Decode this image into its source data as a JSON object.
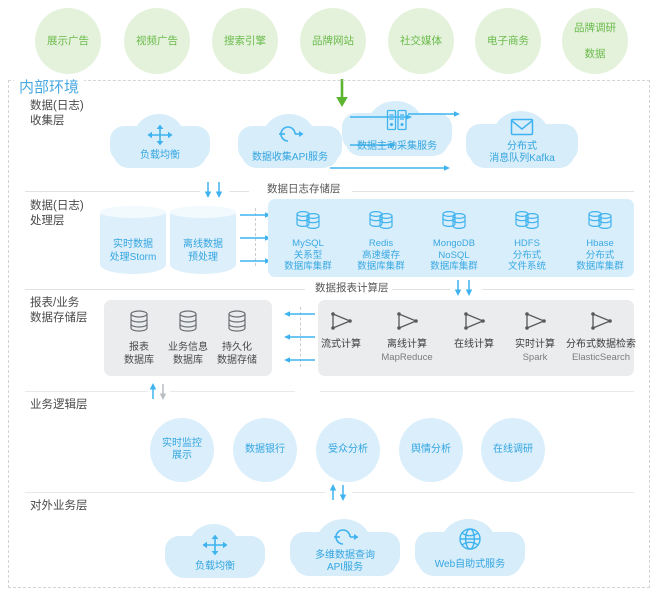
{
  "diagram": {
    "title_internal": "内部环境",
    "external_sources": [
      {
        "label": "展示广告"
      },
      {
        "label": "视频广告"
      },
      {
        "label": "搜索引擎"
      },
      {
        "label": "品牌网站"
      },
      {
        "label": "社交媒体"
      },
      {
        "label": "电子商务"
      },
      {
        "label": "品牌调研\n数据",
        "line1": "品牌调研",
        "line2": "数据"
      }
    ],
    "layers": [
      {
        "id": "collect",
        "label_line1": "数据(日志)",
        "label_line2": "收集层"
      },
      {
        "id": "process",
        "label_line1": "数据(日志)",
        "label_line2": "处理层"
      },
      {
        "id": "report_store",
        "label_line1": "报表/业务",
        "label_line2": "数据存储层"
      },
      {
        "id": "business_logic",
        "label_line1": "业务逻辑层",
        "label_line2": ""
      },
      {
        "id": "external_business",
        "label_line1": "对外业务层",
        "label_line2": ""
      }
    ],
    "sub_layer_titles": {
      "log_storage": "数据日志存储层",
      "report_calc": "数据报表计算层"
    },
    "collect_layer": {
      "clouds": [
        {
          "icon": "load-balancer-icon",
          "line1": "负载均衡",
          "line2": ""
        },
        {
          "icon": "api-refresh-icon",
          "line1": "数据收集API服务",
          "line2": ""
        },
        {
          "icon": "server-rack-icon",
          "line1": "数据主动采集服务",
          "line2": ""
        },
        {
          "icon": "envelope-icon",
          "line1": "分布式",
          "line2": "消息队列Kafka"
        }
      ]
    },
    "process_layer": {
      "cylinders": [
        {
          "line1": "实时数据",
          "line2": "处理Storm"
        },
        {
          "line1": "离线数据",
          "line2": "预处理"
        }
      ],
      "databases": [
        {
          "name": "MySQL",
          "line2": "关系型",
          "line3": "数据库集群"
        },
        {
          "name": "Redis",
          "line2": "高速缓存",
          "line3": "数据库集群"
        },
        {
          "name": "MongoDB",
          "line2": "NoSQL",
          "line3": "数据库集群"
        },
        {
          "name": "HDFS",
          "line2": "分布式",
          "line3": "文件系统"
        },
        {
          "name": "Hbase",
          "line2": "分布式",
          "line3": "数据库集群"
        }
      ]
    },
    "report_store_layer": {
      "databases": [
        {
          "line1": "报表",
          "line2": "数据库"
        },
        {
          "line1": "业务信息",
          "line2": "数据库"
        },
        {
          "line1": "持久化",
          "line2": "数据存储"
        }
      ],
      "compute": [
        {
          "line1": "流式计算",
          "line2": ""
        },
        {
          "line1": "离线计算",
          "line2": "MapReduce"
        },
        {
          "line1": "在线计算",
          "line2": ""
        },
        {
          "line1": "实时计算",
          "line2": "Spark"
        },
        {
          "line1": "分布式数据检索",
          "line2": "ElasticSearch"
        }
      ]
    },
    "business_logic_layer": {
      "items": [
        {
          "line1": "实时监控",
          "line2": "展示"
        },
        {
          "line1": "数据银行",
          "line2": ""
        },
        {
          "line1": "受众分析",
          "line2": ""
        },
        {
          "line1": "舆情分析",
          "line2": ""
        },
        {
          "line1": "在线调研",
          "line2": ""
        }
      ]
    },
    "external_business_layer": {
      "clouds": [
        {
          "icon": "load-balancer-icon",
          "line1": "负载均衡",
          "line2": ""
        },
        {
          "icon": "api-refresh-icon",
          "line1": "多维数据查询",
          "line2": "API服务"
        },
        {
          "icon": "globe-icon",
          "line1": "Web自助式服务",
          "line2": ""
        }
      ]
    },
    "colors": {
      "source_green_fill": "#e4f2dc",
      "source_green_text": "#6aba4a",
      "cloud_blue": "#d7edfa",
      "accent_blue": "#34a5e0",
      "panel_blue": "#d9eefb",
      "panel_gray": "#ebecee",
      "arrow_blue": "#3fb3ef",
      "arrow_green": "#5cb531",
      "arrow_gray": "#b9bec3",
      "divider": "#dfe3e6"
    }
  }
}
